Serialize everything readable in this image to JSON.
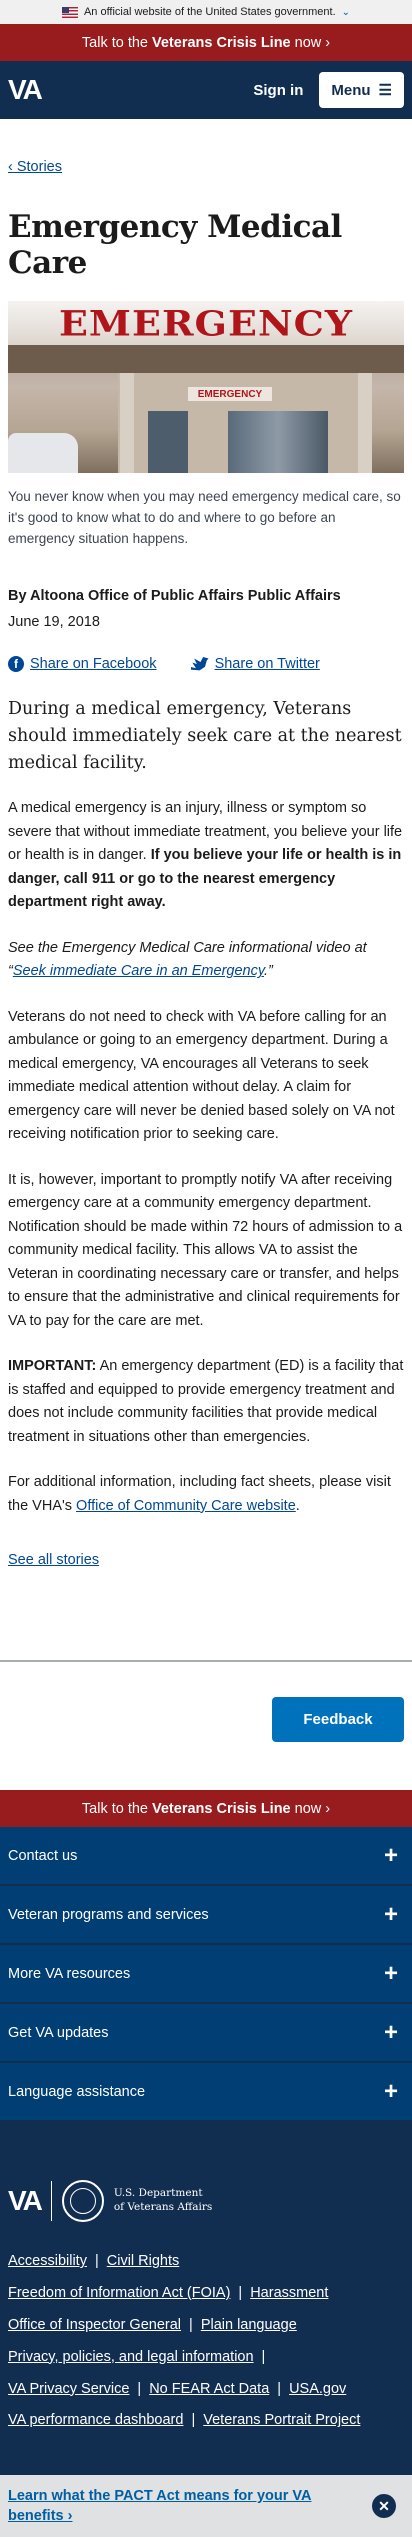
{
  "gov_banner": {
    "text": "An official website of the United States government.",
    "chevron": "chevron-down-icon"
  },
  "crisis_line": {
    "prefix": "Talk to the",
    "strong": "Veterans Crisis Line",
    "suffix": "now",
    "arrow": "›"
  },
  "header": {
    "logo": "VA",
    "sign_in": "Sign in",
    "menu": "Menu",
    "menu_icon": "☰"
  },
  "breadcrumb": {
    "label": "‹ Stories"
  },
  "article": {
    "title": "Emergency Medical Care",
    "image_sign_text": "EMERGENCY",
    "image_small_sign_text": "EMERGENCY",
    "caption": "You never know when you may need emergency medical care, so it's good to know what to do and where to go before an emergency situation happens.",
    "byline": "By Altoona Office of Public Affairs Public Affairs",
    "date": "June 19, 2018",
    "share_facebook": "Share on Facebook",
    "share_twitter": "Share on Twitter",
    "lead": "During a medical emergency, Veterans should immediately seek care at the nearest medical facility.",
    "p1_text": "A medical emergency is an injury, illness or symptom so severe that without immediate treatment, you believe your life or health is in danger.",
    "p1_bold": "If you believe your life or health is in danger, call 911 or go to the nearest emergency department right away.",
    "p2_prefix": "See the Emergency Medical Care informational video at “",
    "p2_link": "Seek immediate Care in an Emergency",
    "p2_suffix": ".”",
    "p3": "Veterans do not need to check with VA before calling for an ambulance or going to an emergency department. During a medical emergency, VA encourages all Veterans to seek immediate medical attention without delay. A claim for emergency care will never be denied based solely on VA not receiving notification prior to seeking care.",
    "p4": "It is, however, important to promptly notify VA after receiving emergency care at a community emergency department. Notification should be made within 72 hours of admission to a community medical facility. This allows VA to assist the Veteran in coordinating necessary care or transfer, and helps to ensure that the administrative and clinical requirements for VA to pay for the care are met.",
    "p5_bold": "IMPORTANT:",
    "p5_text": " An emergency department (ED) is a facility that is staffed and equipped to provide emergency treatment and does not include community facilities that provide medical treatment in situations other than emergencies.",
    "p6_prefix": "For additional information, including fact sheets, please visit the VHA's ",
    "p6_link": "Office of Community Care website",
    "p6_suffix": ".",
    "see_all": "See all stories"
  },
  "feedback": "Feedback",
  "footer": {
    "accordions": [
      "Contact us",
      "Veteran programs and services",
      "More VA resources",
      "Get VA updates",
      "Language assistance"
    ],
    "plus_icon": "+",
    "logo": "VA",
    "dept_line1": "U.S. Department",
    "dept_line2": "of Veterans Affairs",
    "links": [
      [
        "Accessibility",
        "Civil Rights"
      ],
      [
        "Freedom of Information Act (FOIA)",
        "Harassment"
      ],
      [
        "Office of Inspector General",
        "Plain language"
      ],
      [
        "Privacy, policies, and legal information"
      ],
      [
        "VA Privacy Service",
        "No FEAR Act Data",
        "USA.gov"
      ],
      [
        "VA performance dashboard",
        "Veterans Portrait Project"
      ]
    ]
  },
  "pact_banner": {
    "text": "Learn what the PACT Act means for your VA benefits ›",
    "close": "✕"
  },
  "colors": {
    "navy": "#112e51",
    "crisis_red": "#981b1e",
    "link_blue": "#004795",
    "accordion_blue": "#003e73",
    "feedback_blue": "#0071bb"
  }
}
